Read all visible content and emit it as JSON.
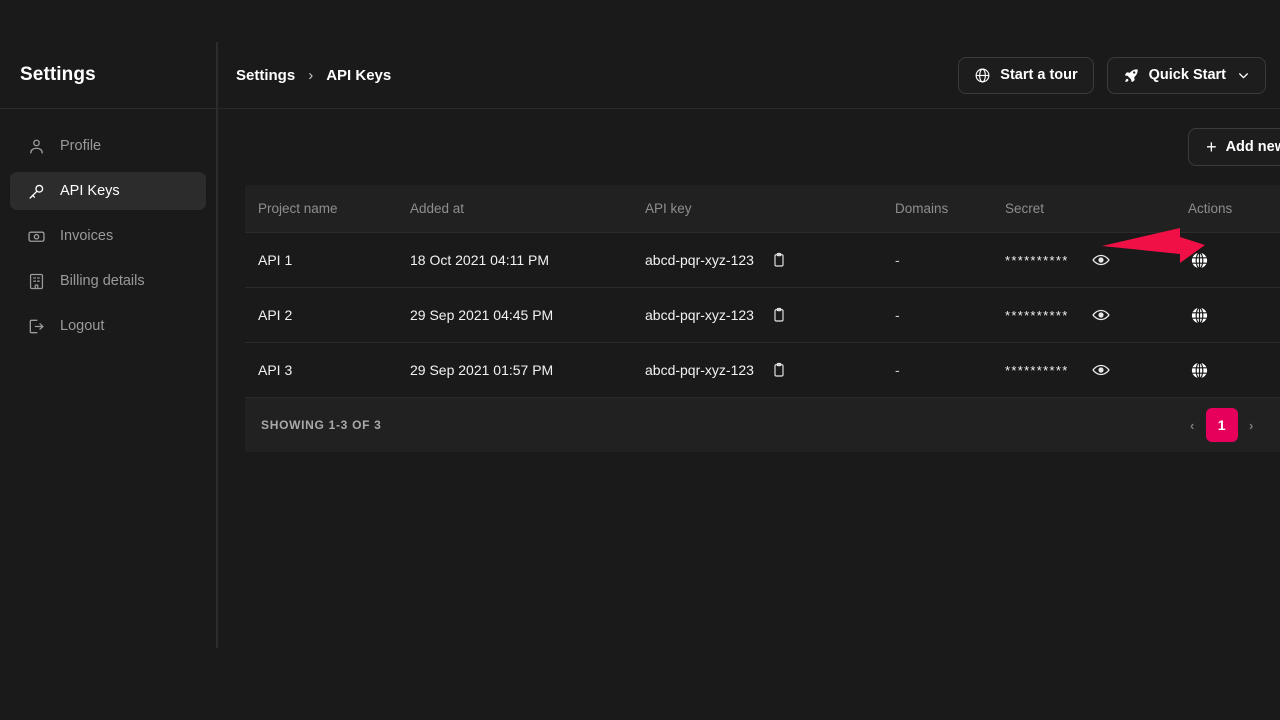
{
  "colors": {
    "accent_pink": "#e6005c",
    "annotation_red": "#f01045",
    "page_bg": "#1a1a1a",
    "row_alt_bg": "#212121",
    "sidebar_active_bg": "#2c2c2c"
  },
  "sidebar": {
    "title": "Settings",
    "items": [
      {
        "label": "Profile",
        "icon": "user-icon",
        "active": false
      },
      {
        "label": "API Keys",
        "icon": "key-icon",
        "active": true
      },
      {
        "label": "Invoices",
        "icon": "invoice-icon",
        "active": false
      },
      {
        "label": "Billing details",
        "icon": "building-icon",
        "active": false
      },
      {
        "label": "Logout",
        "icon": "logout-icon",
        "active": false
      }
    ]
  },
  "topbar": {
    "breadcrumb": {
      "parent": "Settings",
      "separator": "›",
      "current": "API Keys"
    },
    "start_tour_label": "Start a tour",
    "start_tour_icon": "globe-icon",
    "quick_start_label": "Quick Start",
    "quick_start_icon": "rocket-icon",
    "quick_start_chevron": "chevron-down-icon"
  },
  "content": {
    "add_new_label": "Add new",
    "add_new_icon": "plus-icon"
  },
  "table": {
    "columns": [
      "Project name",
      "Added at",
      "API key",
      "Domains",
      "Secret",
      "Actions"
    ],
    "rows": [
      {
        "project_name": "API 1",
        "added_at": "18 Oct 2021 04:11 PM",
        "api_key": "abcd-pqr-xyz-123",
        "copy_icon": "clipboard-icon",
        "domains": "-",
        "secret": "**********",
        "reveal_icon": "eye-icon",
        "action_icon": "globe-icon"
      },
      {
        "project_name": "API 2",
        "added_at": "29 Sep 2021 04:45 PM",
        "api_key": "abcd-pqr-xyz-123",
        "copy_icon": "clipboard-icon",
        "domains": "-",
        "secret": "**********",
        "reveal_icon": "eye-icon",
        "action_icon": "globe-icon"
      },
      {
        "project_name": "API 3",
        "added_at": "29 Sep 2021 01:57 PM",
        "api_key": "abcd-pqr-xyz-123",
        "copy_icon": "clipboard-icon",
        "domains": "-",
        "secret": "**********",
        "reveal_icon": "eye-icon",
        "action_icon": "globe-icon"
      }
    ],
    "footer": {
      "showing": "SHOWING 1-3 OF 3",
      "prev": "‹",
      "next": "›",
      "current_page": "1"
    }
  },
  "annotation": {
    "type": "arrow",
    "points_to": "row-1-action-globe-icon",
    "color": "#f01045"
  }
}
